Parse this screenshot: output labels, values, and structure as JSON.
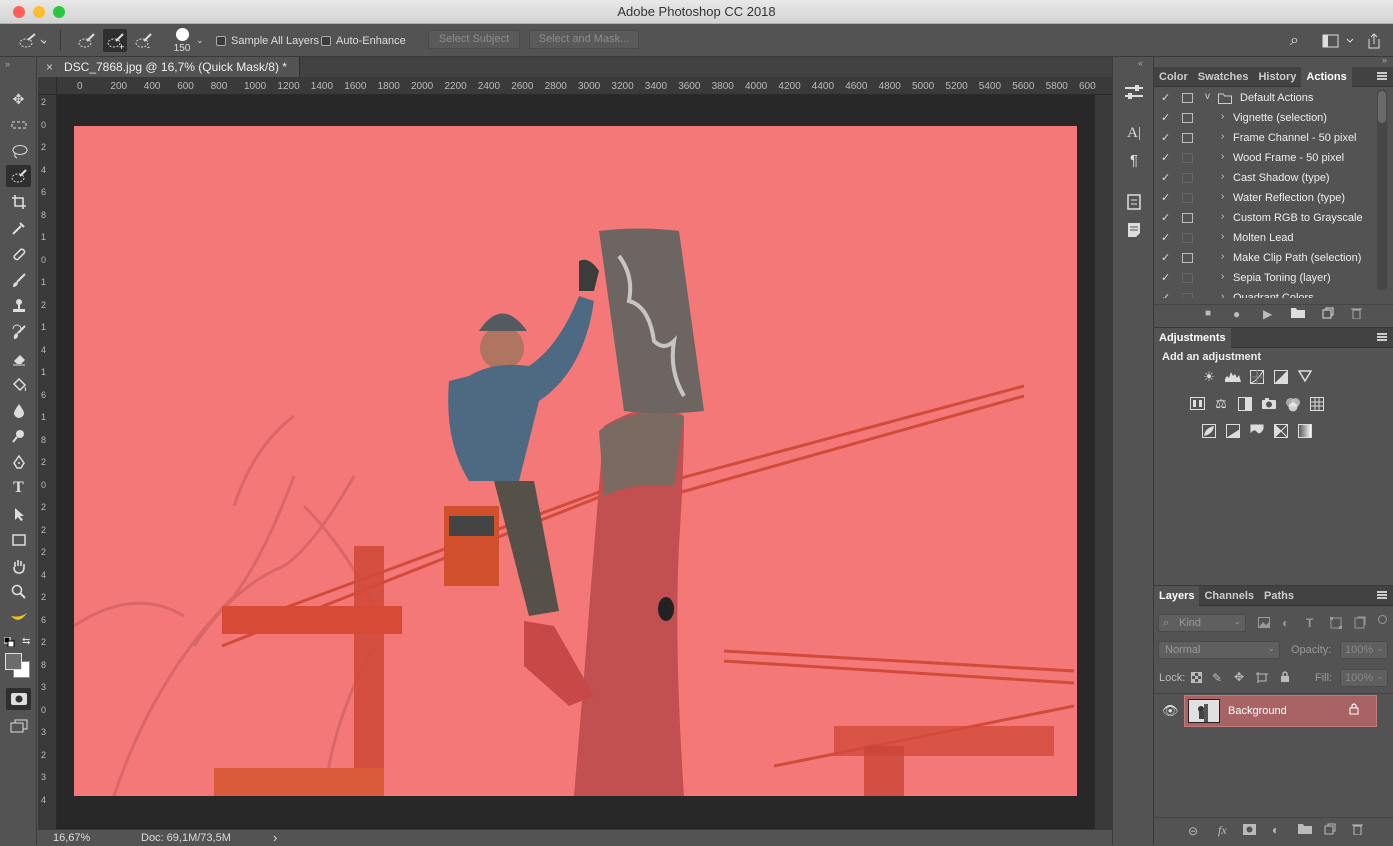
{
  "window": {
    "title": "Adobe Photoshop CC 2018"
  },
  "options_bar": {
    "brush_size": "150",
    "sample_all_layers": "Sample All Layers",
    "auto_enhance": "Auto-Enhance",
    "select_subject": "Select Subject",
    "select_and_mask": "Select and Mask..."
  },
  "document": {
    "tab_title": "DSC_7868.jpg @ 16,7% (Quick Mask/8) *",
    "close": "×"
  },
  "ruler_h": [
    "0",
    "200",
    "400",
    "600",
    "800",
    "1000",
    "1200",
    "1400",
    "1600",
    "1800",
    "2000",
    "2200",
    "2400",
    "2600",
    "2800",
    "3000",
    "3200",
    "3400",
    "3600",
    "3800",
    "4000",
    "4200",
    "4400",
    "4600",
    "4800",
    "5000",
    "5200",
    "5400",
    "5600",
    "5800",
    "600"
  ],
  "ruler_v": [
    "2",
    "0",
    "2",
    "4",
    "6",
    "8",
    "1",
    "0",
    "1",
    "2",
    "1",
    "4",
    "1",
    "6",
    "1",
    "8",
    "2",
    "0",
    "2",
    "2",
    "2",
    "4",
    "2",
    "6",
    "2",
    "8",
    "3",
    "0",
    "3",
    "2",
    "3",
    "4"
  ],
  "status": {
    "zoom": "16,67%",
    "doc": "Doc: 69,1M/73,5M",
    "arrow": "›"
  },
  "color_panel": {
    "tabs": [
      "Color",
      "Swatches",
      "History",
      "Actions"
    ],
    "active": "Actions",
    "actions": [
      {
        "label": "Default Actions",
        "folder": true,
        "dialog": true,
        "twirl": "v"
      },
      {
        "label": "Vignette (selection)",
        "dialog": true,
        "twirl": "›"
      },
      {
        "label": "Frame Channel - 50 pixel",
        "dialog": true,
        "twirl": "›"
      },
      {
        "label": "Wood Frame - 50 pixel",
        "dialog": false,
        "twirl": "›"
      },
      {
        "label": "Cast Shadow (type)",
        "dialog": false,
        "twirl": "›"
      },
      {
        "label": "Water Reflection (type)",
        "dialog": false,
        "twirl": "›"
      },
      {
        "label": "Custom RGB to Grayscale",
        "dialog": true,
        "twirl": "›"
      },
      {
        "label": "Molten Lead",
        "dialog": false,
        "twirl": "›"
      },
      {
        "label": "Make Clip Path (selection)",
        "dialog": true,
        "twirl": "›"
      },
      {
        "label": "Sepia Toning (layer)",
        "dialog": false,
        "twirl": "›"
      },
      {
        "label": "Quadrant Colors",
        "dialog": false,
        "twirl": "›"
      }
    ],
    "check": "✓"
  },
  "adjustments": {
    "title": "Adjustments",
    "subtitle": "Add an adjustment"
  },
  "layers": {
    "tabs": [
      "Layers",
      "Channels",
      "Paths"
    ],
    "kind_placeholder": "Kind",
    "blend_mode": "Normal",
    "opacity_label": "Opacity:",
    "opacity_value": "100%",
    "lock_label": "Lock:",
    "fill_label": "Fill:",
    "fill_value": "100%",
    "layer_name": "Background",
    "footer_fx": "fx"
  },
  "colors": {
    "quick_mask": "#f47878",
    "selected_layer": "#a86364"
  }
}
